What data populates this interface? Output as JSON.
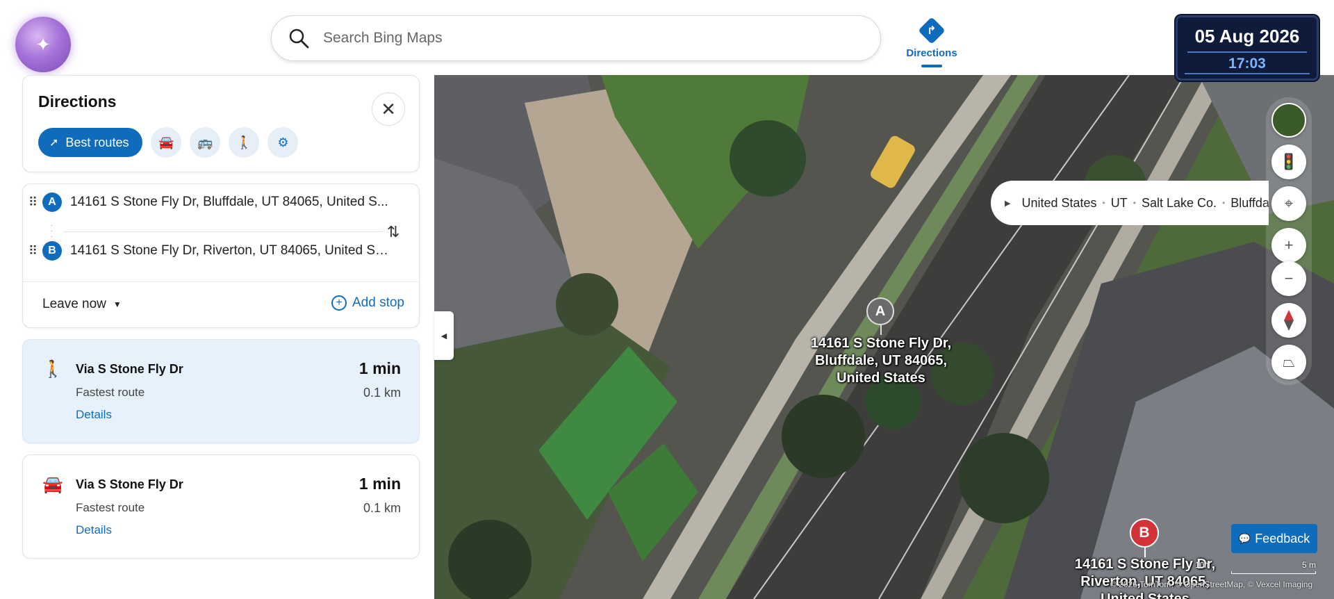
{
  "header": {
    "search_placeholder": "Search Bing Maps",
    "directions_tab": "Directions",
    "date": "05 Aug 2026",
    "time": "17:03"
  },
  "panel": {
    "title": "Directions",
    "best_routes": "Best routes",
    "modes": [
      "car-icon",
      "bus-icon",
      "walk-icon",
      "settings-sliders-icon"
    ],
    "waypoint_a": {
      "letter": "A",
      "text": "14161 S Stone Fly Dr, Bluffdale, UT 84065, United S..."
    },
    "waypoint_b": {
      "letter": "B",
      "text": "14161 S Stone Fly Dr, Riverton, UT 84065, United St..."
    },
    "leave_now": "Leave now",
    "add_stop": "Add stop"
  },
  "routes": [
    {
      "mode": "walk-icon",
      "title": "Via S Stone Fly Dr",
      "subtitle": "Fastest route",
      "details": "Details",
      "time": "1 min",
      "distance": "0.1 km"
    },
    {
      "mode": "car-icon",
      "title": "Via S Stone Fly Dr",
      "subtitle": "Fastest route",
      "details": "Details",
      "time": "1 min",
      "distance": "0.1 km"
    }
  ],
  "map": {
    "breadcrumb": [
      "United States",
      "UT",
      "Salt Lake Co.",
      "Bluffdale"
    ],
    "pin_a": "A",
    "pin_b": "B",
    "label_a": [
      "14161 S Stone Fly Dr,",
      "Bluffdale, UT 84065,",
      "United States"
    ],
    "label_b": [
      "14161 S Stone Fly Dr,",
      "Riverton, UT 84065,",
      "United States"
    ],
    "scale_left": "10ft",
    "scale_right": "5 m",
    "attribution": "© 2026 TomTom, © OpenStreetMap, © Vexcel Imaging",
    "feedback": "Feedback"
  }
}
